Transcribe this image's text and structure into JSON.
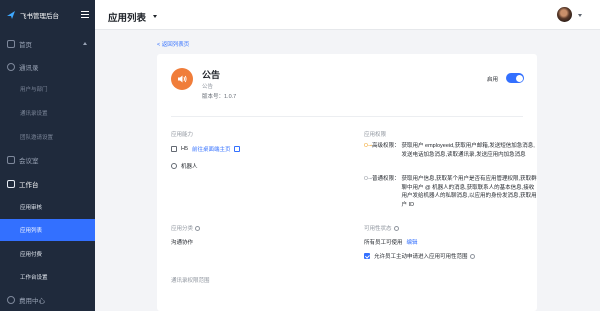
{
  "sidebar": {
    "brand": "飞书管理后台",
    "items": [
      {
        "label": "首页"
      },
      {
        "label": "通讯录"
      },
      {
        "label": "用户与部门"
      },
      {
        "label": "通讯录设置"
      },
      {
        "label": "团队邀请设置"
      },
      {
        "label": "会议室"
      },
      {
        "label": "工作台"
      },
      {
        "label": "应用审核"
      },
      {
        "label": "应用列表"
      },
      {
        "label": "应用付费"
      },
      {
        "label": "工作台设置"
      },
      {
        "label": "费用中心"
      }
    ]
  },
  "header": {
    "title": "应用列表"
  },
  "back_link": "< 返回列表页",
  "app": {
    "name": "公告",
    "subtitle": "公告",
    "version": "版本号：1.0.7",
    "enable_label": "启用"
  },
  "capabilities": {
    "label": "应用能力",
    "h5": "H5",
    "h5_link": "前往桌面端主页",
    "bot": "机器人"
  },
  "permissions": {
    "label": "应用权限",
    "advanced_title": "高级权限：",
    "advanced_text": "获取用户 employeeid,获取用户邮箱,发送短信加急消息,发送电话加急消息,读取通讯录,发送应用内加急消息",
    "normal_title": "普通权限：",
    "normal_text": "获取用户信息,获取某个用户是否有应用管理权限,获取群聊中用户 @ 机器人的消息,获取联系人的基本信息,接收用户发给机器人的私聊消息,以应用的身份发消息,获取用户 ID"
  },
  "category": {
    "label": "应用分类",
    "value": "沟通协作"
  },
  "availability": {
    "label": "可用性状态",
    "value": "所有员工可使用",
    "edit": "编辑",
    "checkbox_label": "允许员工主动申请进入应用可用性范围"
  },
  "contacts_scope": {
    "label": "通讯录权限范围"
  },
  "colors": {
    "accent": "#3370ff",
    "sidebar": "#1f2a3c",
    "app_icon": "#f07d3a"
  }
}
